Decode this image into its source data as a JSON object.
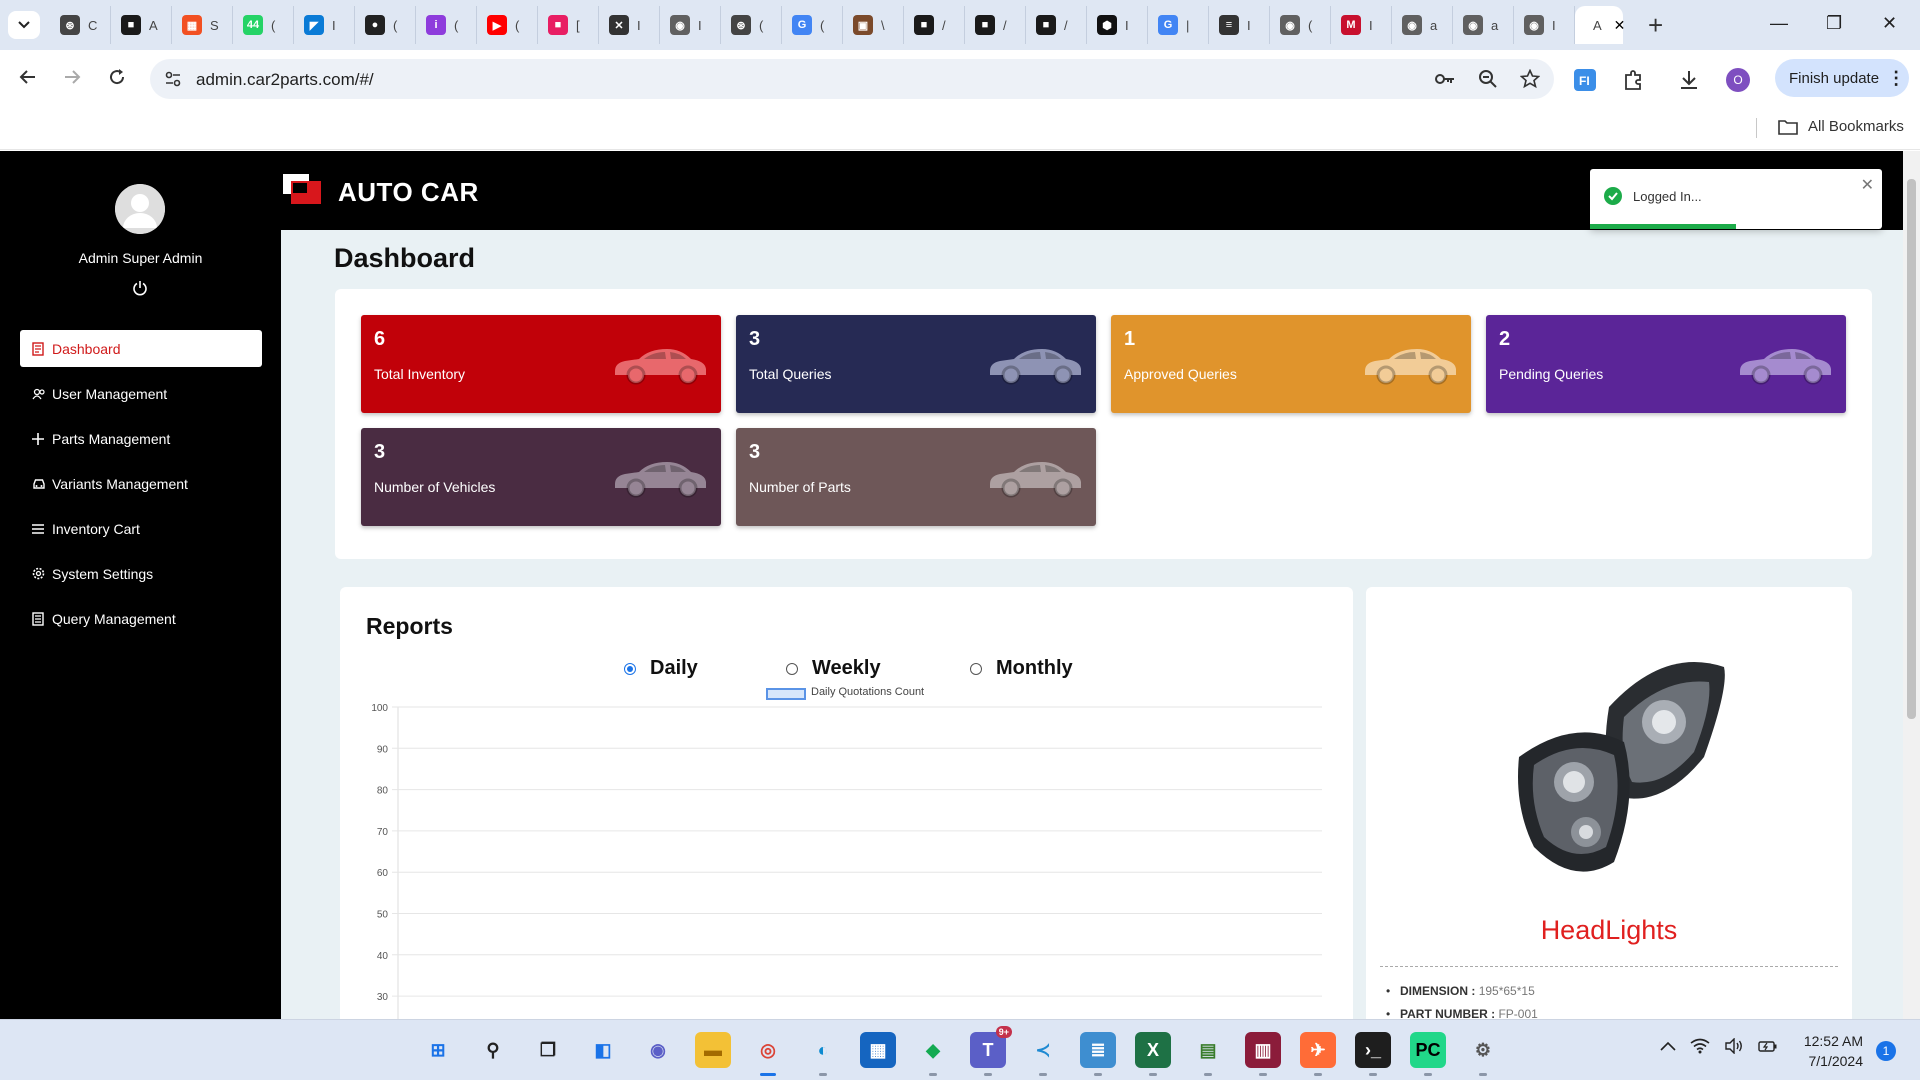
{
  "browser": {
    "tabs": [
      {
        "icon": "openai-favicon",
        "color": "#444444",
        "glyph": "⊛",
        "title": "C"
      },
      {
        "icon": "autocar-favicon",
        "color": "#1a1a1a",
        "glyph": "■",
        "title": "A"
      },
      {
        "icon": "microsoft-favicon",
        "color": "#f25022",
        "glyph": "▦",
        "title": "S"
      },
      {
        "icon": "whatsapp-favicon",
        "color": "#25d366",
        "glyph": "44",
        "title": "("
      },
      {
        "icon": "azure-favicon",
        "color": "#0a7bd6",
        "glyph": "◤",
        "title": "I"
      },
      {
        "icon": "github-favicon",
        "color": "#222222",
        "glyph": "●",
        "title": "("
      },
      {
        "icon": "app-favicon",
        "color": "#8e3cdc",
        "glyph": "i",
        "title": "("
      },
      {
        "icon": "youtube-favicon",
        "color": "#ff0000",
        "glyph": "▶",
        "title": "("
      },
      {
        "icon": "figma-favicon",
        "color": "#e81e63",
        "glyph": "■",
        "title": "["
      },
      {
        "icon": "animal-favicon",
        "color": "#333333",
        "glyph": "✕",
        "title": "I"
      },
      {
        "icon": "globe-favicon",
        "color": "#606060",
        "glyph": "◉",
        "title": "I"
      },
      {
        "icon": "openai-favicon",
        "color": "#444444",
        "glyph": "⊛",
        "title": "("
      },
      {
        "icon": "google-favicon",
        "color": "#4285f4",
        "glyph": "G",
        "title": "("
      },
      {
        "icon": "image-favicon",
        "color": "#7b4a2b",
        "glyph": "▣",
        "title": "\\"
      },
      {
        "icon": "autocar-favicon",
        "color": "#1a1a1a",
        "glyph": "■",
        "title": "/"
      },
      {
        "icon": "autocar-favicon",
        "color": "#1a1a1a",
        "glyph": "■",
        "title": "/"
      },
      {
        "icon": "autocar-favicon",
        "color": "#1a1a1a",
        "glyph": "■",
        "title": "/"
      },
      {
        "icon": "hex-favicon",
        "color": "#111111",
        "glyph": "⬢",
        "title": "I"
      },
      {
        "icon": "google-favicon",
        "color": "#4285f4",
        "glyph": "G",
        "title": "|"
      },
      {
        "icon": "menu-favicon",
        "color": "#333333",
        "glyph": "≡",
        "title": "I"
      },
      {
        "icon": "globe-favicon",
        "color": "#606060",
        "glyph": "◉",
        "title": "("
      },
      {
        "icon": "mcd-favicon",
        "color": "#c8102e",
        "glyph": "M",
        "title": "I"
      },
      {
        "icon": "globe-favicon",
        "color": "#606060",
        "glyph": "◉",
        "title": "a"
      },
      {
        "icon": "globe-favicon",
        "color": "#606060",
        "glyph": "◉",
        "title": "a"
      },
      {
        "icon": "globe-favicon",
        "color": "#606060",
        "glyph": "◉",
        "title": "I"
      }
    ],
    "active_tab_title": "A",
    "url": "admin.car2parts.com/#/",
    "finish_update": "Finish update",
    "profile_initial": "O",
    "all_bookmarks": "All Bookmarks"
  },
  "sidebar": {
    "user_name": "Admin Super Admin",
    "items": [
      {
        "label": "Dashboard",
        "icon": "dashboard-icon",
        "active": true
      },
      {
        "label": "User Management",
        "icon": "users-icon"
      },
      {
        "label": "Parts Management",
        "icon": "plus-icon"
      },
      {
        "label": "Variants Management",
        "icon": "car-icon"
      },
      {
        "label": "Inventory Cart",
        "icon": "list-icon"
      },
      {
        "label": "System Settings",
        "icon": "gear-icon"
      },
      {
        "label": "Query Management",
        "icon": "document-icon"
      }
    ]
  },
  "header": {
    "brand": "AUTO CAR"
  },
  "dashboard": {
    "title": "Dashboard",
    "stats": [
      {
        "value": "6",
        "label": "Total Inventory",
        "color": "#c10109",
        "car_color": "#e8686c"
      },
      {
        "value": "3",
        "label": "Total Queries",
        "color": "#262a54",
        "car_color": "#8e93b4"
      },
      {
        "value": "1",
        "label": "Approved Queries",
        "color": "#e0942c",
        "car_color": "#f2cc97"
      },
      {
        "value": "2",
        "label": "Pending Queries",
        "color": "#5b2598",
        "car_color": "#a58bcf"
      },
      {
        "value": "3",
        "label": "Number of Vehicles",
        "color": "#4a2c42",
        "car_color": "#968595"
      },
      {
        "value": "3",
        "label": "Number of Parts",
        "color": "#6e5758",
        "car_color": "#ada0a1"
      }
    ]
  },
  "reports": {
    "title": "Reports",
    "options": [
      {
        "label": "Daily",
        "selected": true
      },
      {
        "label": "Weekly",
        "selected": false
      },
      {
        "label": "Monthly",
        "selected": false
      }
    ]
  },
  "chart_data": {
    "type": "bar",
    "series": [
      {
        "name": "Daily Quotations Count",
        "values": []
      }
    ],
    "categories": [],
    "yticks": [
      100,
      90,
      80,
      70,
      60,
      50,
      40,
      30
    ],
    "ylim": [
      30,
      100
    ],
    "grid": true,
    "legend": "top-center"
  },
  "product": {
    "name": "HeadLights",
    "specs": [
      {
        "key": "DIMENSION :",
        "value": "195*65*15"
      },
      {
        "key": "PART NUMBER :",
        "value": "FP-001"
      }
    ]
  },
  "toast": {
    "text": "Logged In...",
    "progress": 0.5
  },
  "taskbar": {
    "apps": [
      {
        "icon": "windows-start-icon",
        "bg": "#dde6f4",
        "fg": "#1a73e8",
        "glyph": "⊞"
      },
      {
        "icon": "search-icon",
        "bg": "#dde6f4",
        "fg": "#222222",
        "glyph": "⚲"
      },
      {
        "icon": "task-view-icon",
        "bg": "#dde6f4",
        "fg": "#222222",
        "glyph": "❐"
      },
      {
        "icon": "widgets-icon",
        "bg": "#dde6f4",
        "fg": "#1a73e8",
        "glyph": "◧"
      },
      {
        "icon": "chat-icon",
        "bg": "#dde6f4",
        "fg": "#5b5fc7",
        "glyph": "◉"
      },
      {
        "icon": "file-explorer-icon",
        "bg": "#f3c136",
        "fg": "#a36b00",
        "glyph": "▬"
      },
      {
        "icon": "chrome-icon",
        "bg": "#dde6f4",
        "fg": "#db4437",
        "glyph": "◎",
        "focused": true
      },
      {
        "icon": "edge-icon",
        "bg": "#dde6f4",
        "fg": "#0c8ad0",
        "glyph": "◐",
        "running": true
      },
      {
        "icon": "store-icon",
        "bg": "#1565c0",
        "fg": "#ffffff",
        "glyph": "▦"
      },
      {
        "icon": "mongodb-icon",
        "bg": "#dde6f4",
        "fg": "#13aa52",
        "glyph": "◆",
        "running": true
      },
      {
        "icon": "teams-icon",
        "bg": "#5b5fc7",
        "fg": "#ffffff",
        "glyph": "T",
        "running": true
      },
      {
        "icon": "vscode-icon",
        "bg": "#dde6f4",
        "fg": "#1f8ad2",
        "glyph": "≺",
        "running": true
      },
      {
        "icon": "notepad-icon",
        "bg": "#3e8ed0",
        "fg": "#ffffff",
        "glyph": "≣",
        "running": true
      },
      {
        "icon": "excel-icon",
        "bg": "#1e7145",
        "fg": "#ffffff",
        "glyph": "X",
        "running": true
      },
      {
        "icon": "file-manager-icon",
        "bg": "#dde6f4",
        "fg": "#3a7d2c",
        "glyph": "▤",
        "running": true
      },
      {
        "icon": "winrar-icon",
        "bg": "#8b1c3a",
        "fg": "#ffffff",
        "glyph": "▥",
        "running": true
      },
      {
        "icon": "postman-icon",
        "bg": "#ff6c37",
        "fg": "#ffffff",
        "glyph": "✈",
        "running": true
      },
      {
        "icon": "terminal-icon",
        "bg": "#1e1e1e",
        "fg": "#ffffff",
        "glyph": "›_",
        "running": true
      },
      {
        "icon": "pycharm-icon",
        "bg": "#21d789",
        "fg": "#000000",
        "glyph": "PC",
        "running": true
      },
      {
        "icon": "settings-icon",
        "bg": "#dde6f4",
        "fg": "#555555",
        "glyph": "⚙",
        "running": true
      }
    ],
    "teams_badge": "9+",
    "time": "12:52 AM",
    "date": "7/1/2024",
    "notification_count": "1"
  }
}
